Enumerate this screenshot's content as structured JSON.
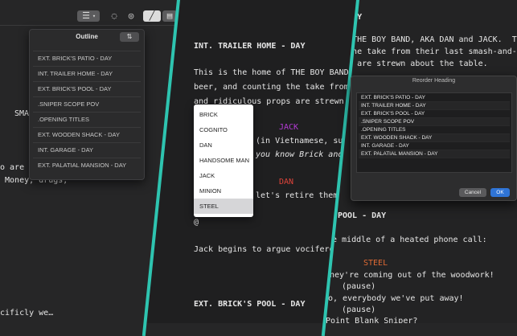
{
  "outline": {
    "title": "Outline",
    "sort_glyph": "⇅",
    "items": [
      "EXT. BRICK'S PATIO - DAY",
      "INT. TRAILER HOME - DAY",
      "EXT. BRICK'S POOL - DAY",
      ".SNIPER SCOPE POV",
      ".OPENING TITLES",
      "EXT. WOODEN SHACK - DAY",
      "INT. GARAGE - DAY",
      "EXT. PALATIAL MANSION - DAY"
    ]
  },
  "panel1": {
    "lines": [
      "SMAS",
      "o are d",
      " Money, drugs,",
      "cificly we…"
    ]
  },
  "panel2": {
    "heading1": "INT. TRAILER HOME - DAY",
    "action1": "This is the home of THE BOY BAND, AKA",
    "action2": "beer, and counting the take from the",
    "action3": "and ridiculous props are strewn abou",
    "char_jack": "JACK",
    "paren_viet": "(in Vietnamese, subti",
    "dialogue_jack": "you know Brick and S",
    "char_dan": "DAN",
    "dialogue_dan": "let's retire them.",
    "at_sign": "@",
    "action4": "Jack begins to argue vociferousl",
    "heading2": "EXT. BRICK'S POOL - DAY"
  },
  "dropdown": {
    "options": [
      "BRICK",
      "COGNITO",
      "DAN",
      "HANDSOME MAN",
      "JACK",
      "MINION",
      "STEEL"
    ]
  },
  "panel3": {
    "heading_top": "- DAY",
    "action1": "of THE BOY BAND, AKA DAN and JACK.  They to",
    "action2": "g the take from their last smash-and-grab.  Ha",
    "action3": "ops are strewn about the table.",
    "heading_pool": "POOL - DAY",
    "action4": "e middle of a heated phone call:",
    "char_steel": "STEEL",
    "dialogue1": "hey're coming out of the woodwork!",
    "paren1": "(pause)",
    "dialogue2": "o, everybody we've put away!",
    "paren2": "(pause)",
    "dialogue3": "Point Blank Sniper?"
  },
  "dialog": {
    "title": "Reorder Heading",
    "rows": [
      "EXT. BRICK'S PATIO - DAY",
      "INT. TRAILER HOME - DAY",
      "EXT. BRICK'S POOL - DAY",
      ".SNIPER SCOPE POV",
      ".OPENING TITLES",
      "EXT. WOODEN SHACK - DAY",
      "INT. GARAGE - DAY",
      "EXT. PALATIAL MANSION - DAY"
    ],
    "cancel": "Cancel",
    "ok": "OK"
  },
  "colors": {
    "accent_divider": "#2ec4b0",
    "jack": "#b43bd6",
    "dan": "#e0443a",
    "steel": "#e06a34",
    "ok_button": "#2f74d6"
  }
}
